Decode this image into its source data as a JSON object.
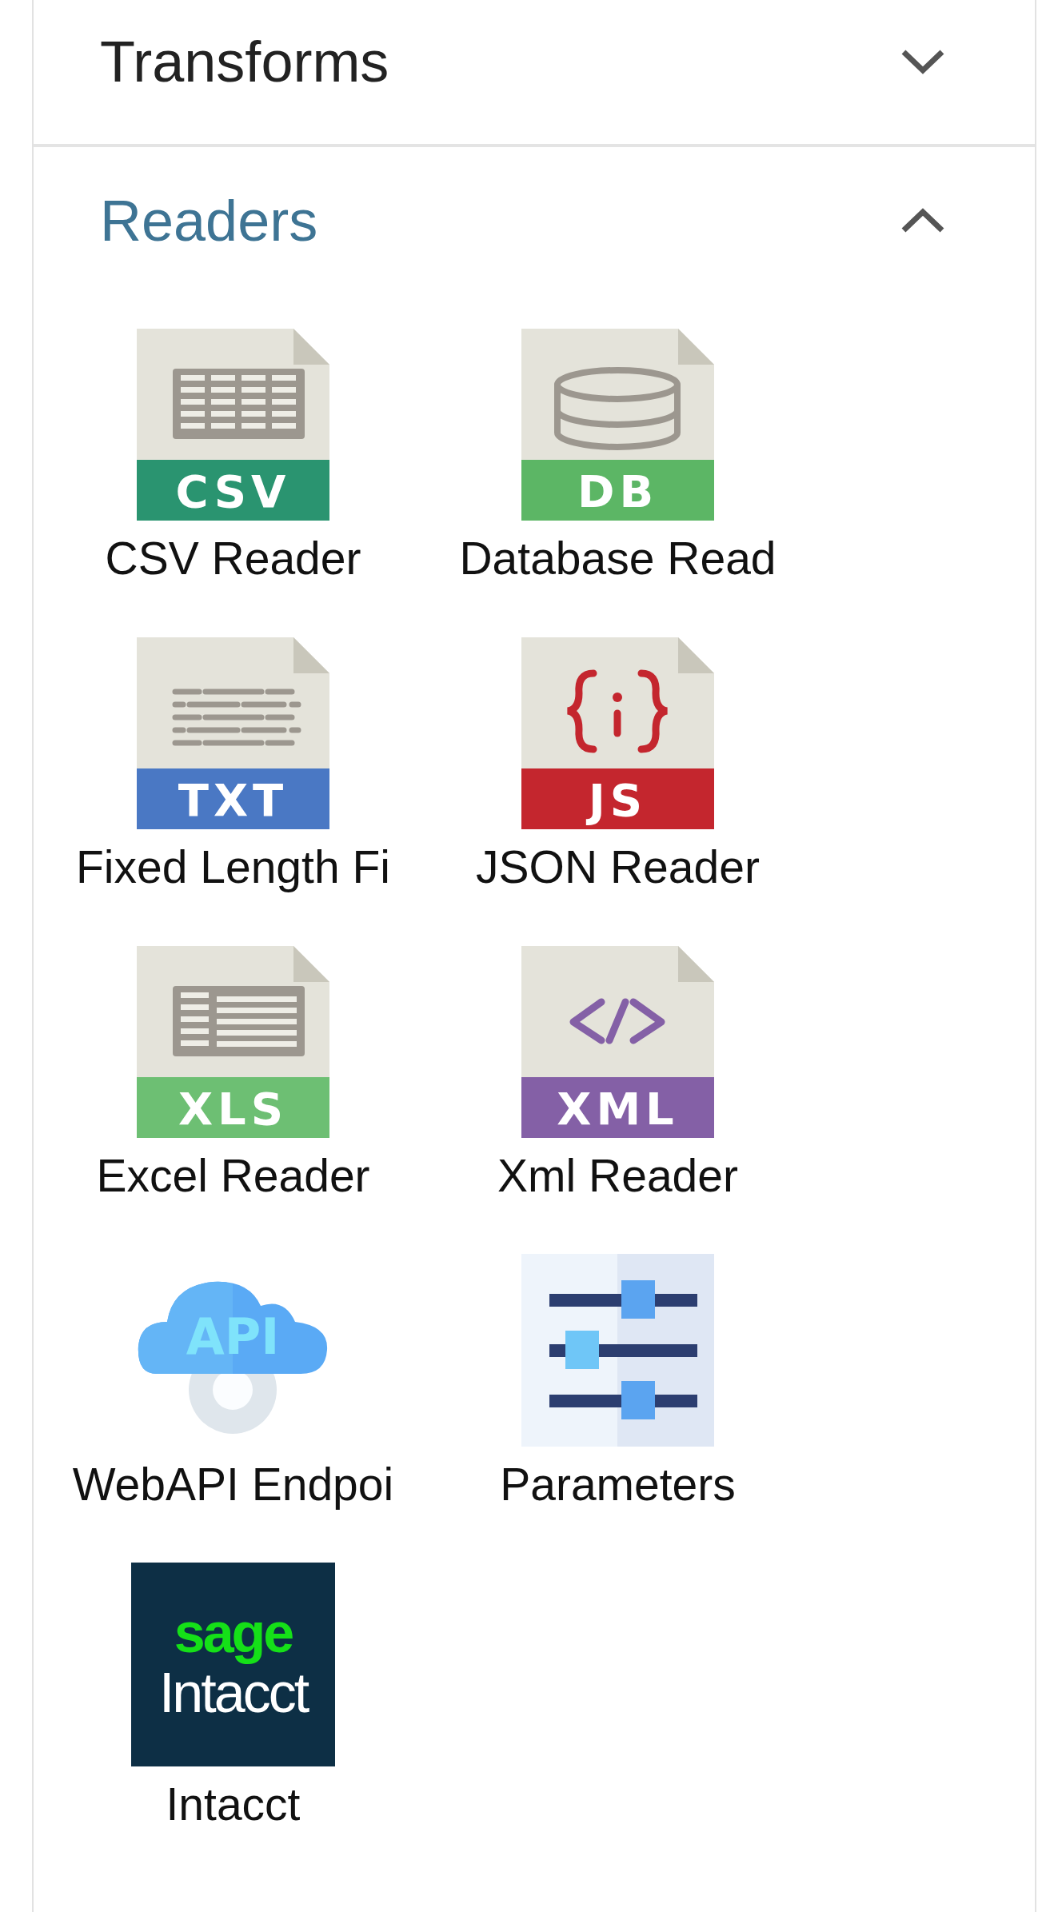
{
  "sections": [
    {
      "title": "Transforms",
      "expanded": false
    },
    {
      "title": "Readers",
      "expanded": true,
      "items": [
        {
          "label": "CSV Reader",
          "kind": "csv",
          "badge": "CSV",
          "color": "#2a9470"
        },
        {
          "label": "Database Read",
          "kind": "db",
          "badge": "DB",
          "color": "#5cb665"
        },
        {
          "label": "Fixed Length Fi",
          "kind": "txt",
          "badge": "TXT",
          "color": "#4a78c4"
        },
        {
          "label": "JSON Reader",
          "kind": "js",
          "badge": "JS",
          "color": "#c4262e"
        },
        {
          "label": "Excel Reader",
          "kind": "xls",
          "badge": "XLS",
          "color": "#6dbf73"
        },
        {
          "label": "Xml Reader",
          "kind": "xml",
          "badge": "XML",
          "color": "#8460a6"
        },
        {
          "label": "WebAPI Endpoi",
          "kind": "api",
          "badge": "API"
        },
        {
          "label": "Parameters",
          "kind": "sliders"
        },
        {
          "label": "Intacct",
          "kind": "logo",
          "logo_text": [
            "sage",
            "Intacct"
          ]
        }
      ]
    }
  ]
}
